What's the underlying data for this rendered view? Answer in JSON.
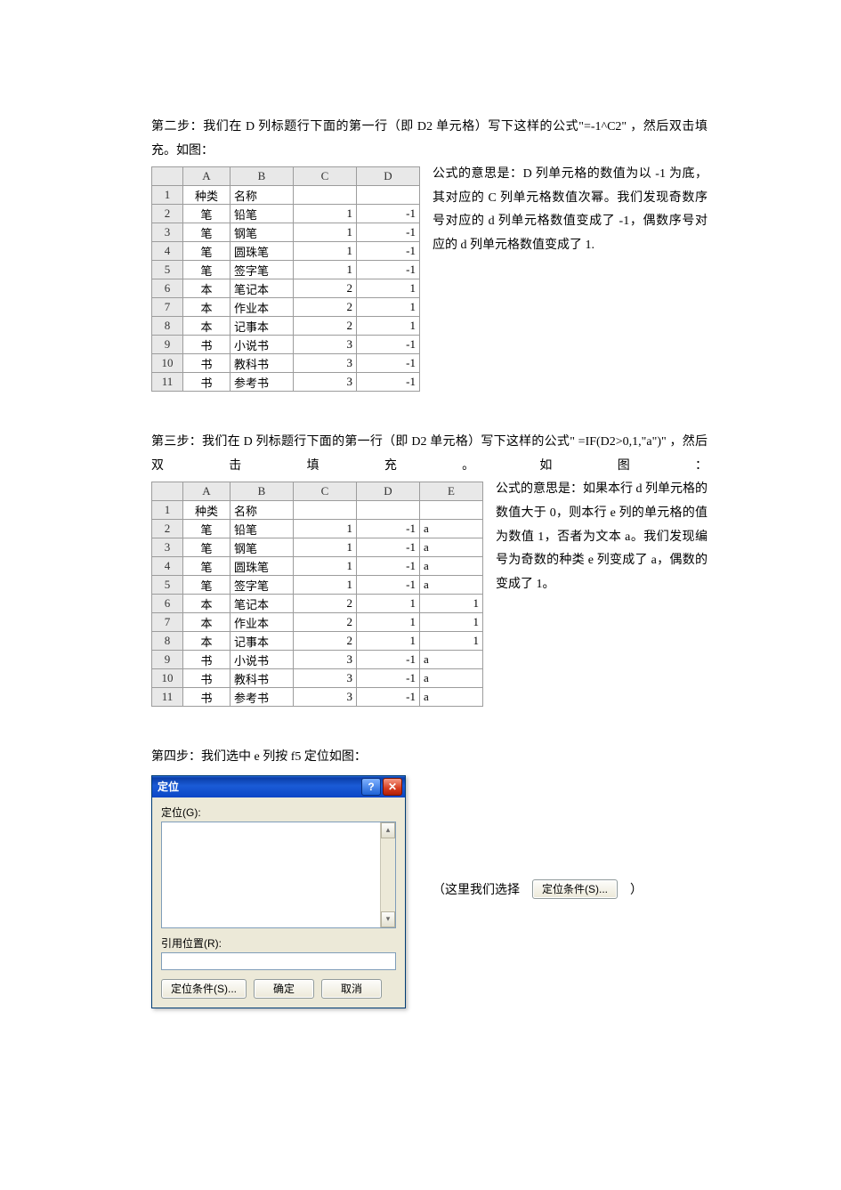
{
  "step2": {
    "intro": "第二步：我们在 D 列标题行下面的第一行（即 D2 单元格）写下这样的公式\"=-1^C2\"  ，然后双击填充。如图：",
    "explain": "公式的意思是：D 列单元格的数值为以 -1 为底，其对应的 C 列单元格数值次幂。我们发现奇数序号对应的 d 列单元格数值变成了 -1，偶数序号对应的 d 列单元格数值变成了 1."
  },
  "step3": {
    "intro": "第三步：我们在 D 列标题行下面的第一行（即 D2 单元格）写下这样的公式\" =IF(D2>0,1,\"a\")\"  ，然后双击填充。如图：",
    "explain": "公式的意思是：如果本行 d 列单元格的数值大于 0，则本行 e 列的单元格的值为数值 1，否者为文本 a。我们发现编号为奇数的种类 e 列变成了 a，偶数的变成了 1。"
  },
  "step4": {
    "intro": "第四步：我们选中 e 列按 f5 定位如图：",
    "aside_prefix": "（这里我们选择",
    "aside_button": "定位条件(S)...",
    "aside_suffix": "）"
  },
  "dialog": {
    "title": "定位",
    "goto_label": "定位(G):",
    "ref_label": "引用位置(R):",
    "ref_value": "",
    "special_btn": "定位条件(S)...",
    "ok_btn": "确定",
    "cancel_btn": "取消"
  },
  "table_headers": {
    "A": "A",
    "B": "B",
    "C": "C",
    "D": "D",
    "E": "E",
    "col_a_title": "种类",
    "col_b_title": "名称"
  },
  "table1_rows": [
    {
      "n": "1",
      "a": "种类",
      "b": "名称",
      "c": "",
      "d": ""
    },
    {
      "n": "2",
      "a": "笔",
      "b": "铅笔",
      "c": "1",
      "d": "-1"
    },
    {
      "n": "3",
      "a": "笔",
      "b": "钢笔",
      "c": "1",
      "d": "-1"
    },
    {
      "n": "4",
      "a": "笔",
      "b": "圆珠笔",
      "c": "1",
      "d": "-1"
    },
    {
      "n": "5",
      "a": "笔",
      "b": "签字笔",
      "c": "1",
      "d": "-1"
    },
    {
      "n": "6",
      "a": "本",
      "b": "笔记本",
      "c": "2",
      "d": "1"
    },
    {
      "n": "7",
      "a": "本",
      "b": "作业本",
      "c": "2",
      "d": "1"
    },
    {
      "n": "8",
      "a": "本",
      "b": "记事本",
      "c": "2",
      "d": "1"
    },
    {
      "n": "9",
      "a": "书",
      "b": "小说书",
      "c": "3",
      "d": "-1"
    },
    {
      "n": "10",
      "a": "书",
      "b": "教科书",
      "c": "3",
      "d": "-1"
    },
    {
      "n": "11",
      "a": "书",
      "b": "参考书",
      "c": "3",
      "d": "-1"
    }
  ],
  "table2_rows": [
    {
      "n": "1",
      "a": "种类",
      "b": "名称",
      "c": "",
      "d": "",
      "e": ""
    },
    {
      "n": "2",
      "a": "笔",
      "b": "铅笔",
      "c": "1",
      "d": "-1",
      "e": "a"
    },
    {
      "n": "3",
      "a": "笔",
      "b": "钢笔",
      "c": "1",
      "d": "-1",
      "e": "a"
    },
    {
      "n": "4",
      "a": "笔",
      "b": "圆珠笔",
      "c": "1",
      "d": "-1",
      "e": "a"
    },
    {
      "n": "5",
      "a": "笔",
      "b": "签字笔",
      "c": "1",
      "d": "-1",
      "e": "a"
    },
    {
      "n": "6",
      "a": "本",
      "b": "笔记本",
      "c": "2",
      "d": "1",
      "e": "1"
    },
    {
      "n": "7",
      "a": "本",
      "b": "作业本",
      "c": "2",
      "d": "1",
      "e": "1"
    },
    {
      "n": "8",
      "a": "本",
      "b": "记事本",
      "c": "2",
      "d": "1",
      "e": "1"
    },
    {
      "n": "9",
      "a": "书",
      "b": "小说书",
      "c": "3",
      "d": "-1",
      "e": "a"
    },
    {
      "n": "10",
      "a": "书",
      "b": "教科书",
      "c": "3",
      "d": "-1",
      "e": "a"
    },
    {
      "n": "11",
      "a": "书",
      "b": "参考书",
      "c": "3",
      "d": "-1",
      "e": "a"
    }
  ]
}
